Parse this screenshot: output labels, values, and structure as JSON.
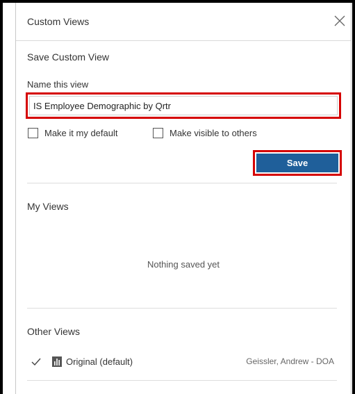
{
  "dialog": {
    "title": "Custom Views",
    "close_icon": "close-icon"
  },
  "save_section": {
    "title": "Save Custom View",
    "name_label": "Name this view",
    "name_value": "IS Employee Demographic by Qrtr",
    "checkbox_default": {
      "label": "Make it my default",
      "checked": false
    },
    "checkbox_visible": {
      "label": "Make visible to others",
      "checked": false
    },
    "save_label": "Save",
    "save_color": "#1f5f9a",
    "highlight_color": "#d50000"
  },
  "my_views": {
    "title": "My Views",
    "empty_text": "Nothing saved yet"
  },
  "other_views": {
    "title": "Other Views",
    "items": [
      {
        "name": "Original (default)",
        "owner": "Geissler, Andrew - DOA",
        "selected": true,
        "icon": "bar-chart-icon"
      }
    ]
  }
}
